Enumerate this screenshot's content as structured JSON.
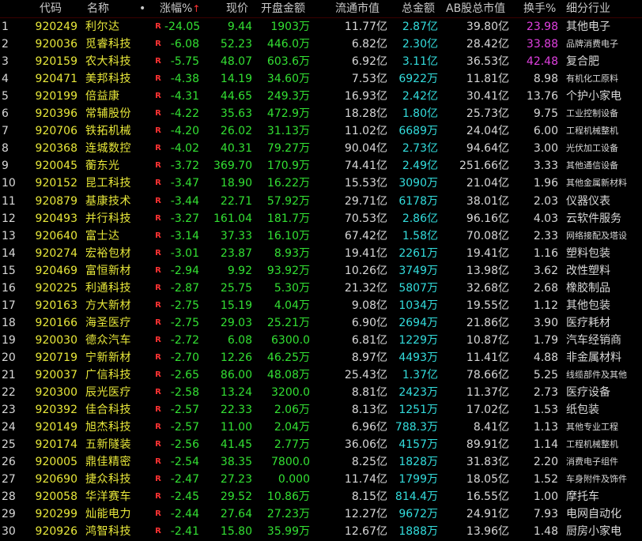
{
  "colors": {
    "background": "#000000",
    "code_name": "#e8e83a",
    "down_green": "#33e033",
    "amount_cyan": "#33dddd",
    "high_turnover": "#e040e0",
    "r_badge": "#ff3333"
  },
  "header": {
    "code": "代码",
    "name": "名称",
    "dot": "•",
    "change": "涨幅%",
    "sort_arrow": "↑",
    "price": "现价",
    "open_amount": "开盘金额",
    "float_mcap": "流通市值",
    "amount": "总金额",
    "ab_mcap": "AB股总市值",
    "turnover": "换手%",
    "industry": "细分行业"
  },
  "rows": [
    {
      "idx": "1",
      "code": "920249",
      "name": "利尔达",
      "r": "R",
      "change": "-24.05",
      "price": "9.44",
      "open": "1903万",
      "float_mcap": "11.77亿",
      "amount": "2.87亿",
      "ab_mcap": "39.80亿",
      "turnover": "23.98",
      "industry": "其他电子",
      "turn_hl": true,
      "ind_small": false
    },
    {
      "idx": "2",
      "code": "920036",
      "name": "觅睿科技",
      "r": "R",
      "change": "-6.08",
      "price": "52.23",
      "open": "446.0万",
      "float_mcap": "6.82亿",
      "amount": "2.30亿",
      "ab_mcap": "28.42亿",
      "turnover": "33.88",
      "industry": "品牌消费电子",
      "turn_hl": true,
      "ind_small": true
    },
    {
      "idx": "3",
      "code": "920159",
      "name": "农大科技",
      "r": "R",
      "change": "-5.75",
      "price": "48.07",
      "open": "603.6万",
      "float_mcap": "6.92亿",
      "amount": "3.11亿",
      "ab_mcap": "36.53亿",
      "turnover": "42.48",
      "industry": "复合肥",
      "turn_hl": true,
      "ind_small": false
    },
    {
      "idx": "4",
      "code": "920471",
      "name": "美邦科技",
      "r": "R",
      "change": "-4.38",
      "price": "14.19",
      "open": "34.60万",
      "float_mcap": "7.53亿",
      "amount": "6922万",
      "ab_mcap": "11.81亿",
      "turnover": "8.98",
      "industry": "有机化工原料",
      "turn_hl": false,
      "ind_small": true
    },
    {
      "idx": "5",
      "code": "920199",
      "name": "倍益康",
      "r": "R",
      "change": "-4.31",
      "price": "44.65",
      "open": "249.3万",
      "float_mcap": "16.93亿",
      "amount": "2.42亿",
      "ab_mcap": "30.41亿",
      "turnover": "13.76",
      "industry": "个护小家电",
      "turn_hl": false,
      "ind_small": false
    },
    {
      "idx": "6",
      "code": "920396",
      "name": "常辅股份",
      "r": "R",
      "change": "-4.22",
      "price": "35.63",
      "open": "472.9万",
      "float_mcap": "18.28亿",
      "amount": "1.80亿",
      "ab_mcap": "25.73亿",
      "turnover": "9.75",
      "industry": "工业控制设备",
      "turn_hl": false,
      "ind_small": true
    },
    {
      "idx": "7",
      "code": "920706",
      "name": "铁拓机械",
      "r": "R",
      "change": "-4.20",
      "price": "26.02",
      "open": "31.13万",
      "float_mcap": "11.02亿",
      "amount": "6689万",
      "ab_mcap": "24.04亿",
      "turnover": "6.00",
      "industry": "工程机械整机",
      "turn_hl": false,
      "ind_small": true
    },
    {
      "idx": "8",
      "code": "920368",
      "name": "连城数控",
      "r": "R",
      "change": "-4.02",
      "price": "40.31",
      "open": "79.27万",
      "float_mcap": "90.04亿",
      "amount": "2.73亿",
      "ab_mcap": "94.64亿",
      "turnover": "3.00",
      "industry": "光伏加工设备",
      "turn_hl": false,
      "ind_small": true
    },
    {
      "idx": "9",
      "code": "920045",
      "name": "蘅东光",
      "r": "R",
      "change": "-3.72",
      "price": "369.70",
      "open": "170.9万",
      "float_mcap": "74.41亿",
      "amount": "2.49亿",
      "ab_mcap": "251.66亿",
      "turnover": "3.33",
      "industry": "其他通信设备",
      "turn_hl": false,
      "ind_small": true
    },
    {
      "idx": "10",
      "code": "920152",
      "name": "昆工科技",
      "r": "R",
      "change": "-3.47",
      "price": "18.90",
      "open": "16.22万",
      "float_mcap": "15.53亿",
      "amount": "3090万",
      "ab_mcap": "21.04亿",
      "turnover": "1.96",
      "industry": "其他金属新材料",
      "turn_hl": false,
      "ind_small": true
    },
    {
      "idx": "11",
      "code": "920879",
      "name": "基康技术",
      "r": "R",
      "change": "-3.44",
      "price": "22.71",
      "open": "57.92万",
      "float_mcap": "29.71亿",
      "amount": "6178万",
      "ab_mcap": "38.01亿",
      "turnover": "2.03",
      "industry": "仪器仪表",
      "turn_hl": false,
      "ind_small": false
    },
    {
      "idx": "12",
      "code": "920493",
      "name": "并行科技",
      "r": "R",
      "change": "-3.27",
      "price": "161.04",
      "open": "181.7万",
      "float_mcap": "70.53亿",
      "amount": "2.86亿",
      "ab_mcap": "96.16亿",
      "turnover": "4.03",
      "industry": "云软件服务",
      "turn_hl": false,
      "ind_small": false
    },
    {
      "idx": "13",
      "code": "920640",
      "name": "富士达",
      "r": "R",
      "change": "-3.14",
      "price": "37.33",
      "open": "16.10万",
      "float_mcap": "67.42亿",
      "amount": "1.58亿",
      "ab_mcap": "70.08亿",
      "turnover": "2.33",
      "industry": "网络接配及塔设",
      "turn_hl": false,
      "ind_small": true
    },
    {
      "idx": "14",
      "code": "920274",
      "name": "宏裕包材",
      "r": "R",
      "change": "-3.01",
      "price": "23.87",
      "open": "8.93万",
      "float_mcap": "19.41亿",
      "amount": "2261万",
      "ab_mcap": "19.41亿",
      "turnover": "1.16",
      "industry": "塑料包装",
      "turn_hl": false,
      "ind_small": false
    },
    {
      "idx": "15",
      "code": "920469",
      "name": "富恒新材",
      "r": "R",
      "change": "-2.94",
      "price": "9.92",
      "open": "93.92万",
      "float_mcap": "10.26亿",
      "amount": "3749万",
      "ab_mcap": "13.98亿",
      "turnover": "3.62",
      "industry": "改性塑料",
      "turn_hl": false,
      "ind_small": false
    },
    {
      "idx": "16",
      "code": "920225",
      "name": "利通科技",
      "r": "R",
      "change": "-2.87",
      "price": "25.75",
      "open": "5.30万",
      "float_mcap": "21.32亿",
      "amount": "5807万",
      "ab_mcap": "32.68亿",
      "turnover": "2.68",
      "industry": "橡胶制品",
      "turn_hl": false,
      "ind_small": false
    },
    {
      "idx": "17",
      "code": "920163",
      "name": "方大新材",
      "r": "R",
      "change": "-2.75",
      "price": "15.19",
      "open": "4.04万",
      "float_mcap": "9.08亿",
      "amount": "1034万",
      "ab_mcap": "19.55亿",
      "turnover": "1.12",
      "industry": "其他包装",
      "turn_hl": false,
      "ind_small": false
    },
    {
      "idx": "18",
      "code": "920166",
      "name": "海圣医疗",
      "r": "R",
      "change": "-2.75",
      "price": "29.03",
      "open": "25.21万",
      "float_mcap": "6.90亿",
      "amount": "2694万",
      "ab_mcap": "21.86亿",
      "turnover": "3.90",
      "industry": "医疗耗材",
      "turn_hl": false,
      "ind_small": false
    },
    {
      "idx": "19",
      "code": "920030",
      "name": "德众汽车",
      "r": "R",
      "change": "-2.72",
      "price": "6.08",
      "open": "6300.0",
      "float_mcap": "6.81亿",
      "amount": "1229万",
      "ab_mcap": "10.87亿",
      "turnover": "1.79",
      "industry": "汽车经销商",
      "turn_hl": false,
      "ind_small": false
    },
    {
      "idx": "20",
      "code": "920719",
      "name": "宁新新材",
      "r": "R",
      "change": "-2.70",
      "price": "12.26",
      "open": "46.25万",
      "float_mcap": "8.97亿",
      "amount": "4493万",
      "ab_mcap": "11.41亿",
      "turnover": "4.88",
      "industry": "非金属材料",
      "turn_hl": false,
      "ind_small": false
    },
    {
      "idx": "21",
      "code": "920037",
      "name": "广信科技",
      "r": "R",
      "change": "-2.65",
      "price": "86.00",
      "open": "48.08万",
      "float_mcap": "25.43亿",
      "amount": "1.37亿",
      "ab_mcap": "78.66亿",
      "turnover": "5.25",
      "industry": "线缆部件及其他",
      "turn_hl": false,
      "ind_small": true
    },
    {
      "idx": "22",
      "code": "920300",
      "name": "辰光医疗",
      "r": "R",
      "change": "-2.58",
      "price": "13.24",
      "open": "3200.0",
      "float_mcap": "8.81亿",
      "amount": "2423万",
      "ab_mcap": "11.37亿",
      "turnover": "2.73",
      "industry": "医疗设备",
      "turn_hl": false,
      "ind_small": false
    },
    {
      "idx": "23",
      "code": "920392",
      "name": "佳合科技",
      "r": "R",
      "change": "-2.57",
      "price": "22.33",
      "open": "2.06万",
      "float_mcap": "8.13亿",
      "amount": "1251万",
      "ab_mcap": "17.02亿",
      "turnover": "1.53",
      "industry": "纸包装",
      "turn_hl": false,
      "ind_small": false
    },
    {
      "idx": "24",
      "code": "920149",
      "name": "旭杰科技",
      "r": "R",
      "change": "-2.57",
      "price": "11.00",
      "open": "2.04万",
      "float_mcap": "6.96亿",
      "amount": "788.3万",
      "ab_mcap": "8.41亿",
      "turnover": "1.13",
      "industry": "其他专业工程",
      "turn_hl": false,
      "ind_small": true
    },
    {
      "idx": "25",
      "code": "920174",
      "name": "五新隧装",
      "r": "R",
      "change": "-2.56",
      "price": "41.45",
      "open": "2.77万",
      "float_mcap": "36.06亿",
      "amount": "4157万",
      "ab_mcap": "89.91亿",
      "turnover": "1.14",
      "industry": "工程机械整机",
      "turn_hl": false,
      "ind_small": true
    },
    {
      "idx": "26",
      "code": "920005",
      "name": "鼎佳精密",
      "r": "R",
      "change": "-2.54",
      "price": "38.35",
      "open": "7800.0",
      "float_mcap": "8.25亿",
      "amount": "1828万",
      "ab_mcap": "31.83亿",
      "turnover": "2.20",
      "industry": "消费电子组件",
      "turn_hl": false,
      "ind_small": true
    },
    {
      "idx": "27",
      "code": "920690",
      "name": "捷众科技",
      "r": "R",
      "change": "-2.47",
      "price": "27.23",
      "open": "0.000",
      "float_mcap": "11.74亿",
      "amount": "1799万",
      "ab_mcap": "18.05亿",
      "turnover": "1.52",
      "industry": "车身附件及饰件",
      "turn_hl": false,
      "ind_small": true
    },
    {
      "idx": "28",
      "code": "920058",
      "name": "华洋赛车",
      "r": "R",
      "change": "-2.45",
      "price": "29.52",
      "open": "10.86万",
      "float_mcap": "8.15亿",
      "amount": "814.4万",
      "ab_mcap": "16.55亿",
      "turnover": "1.00",
      "industry": "摩托车",
      "turn_hl": false,
      "ind_small": false
    },
    {
      "idx": "29",
      "code": "920299",
      "name": "灿能电力",
      "r": "R",
      "change": "-2.44",
      "price": "27.64",
      "open": "27.23万",
      "float_mcap": "12.27亿",
      "amount": "9672万",
      "ab_mcap": "24.91亿",
      "turnover": "7.93",
      "industry": "电网自动化",
      "turn_hl": false,
      "ind_small": false
    },
    {
      "idx": "30",
      "code": "920926",
      "name": "鸿智科技",
      "r": "R",
      "change": "-2.41",
      "price": "15.80",
      "open": "35.99万",
      "float_mcap": "12.67亿",
      "amount": "1888万",
      "ab_mcap": "13.96亿",
      "turnover": "1.48",
      "industry": "厨房小家电",
      "turn_hl": false,
      "ind_small": false
    }
  ]
}
